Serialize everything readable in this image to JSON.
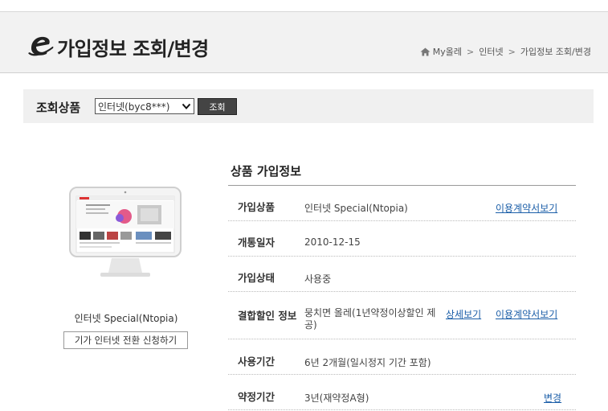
{
  "header": {
    "title": "가입정보 조회/변경",
    "breadcrumb": [
      "My올레",
      "인터넷",
      "가입정보 조회/변경"
    ],
    "breadcrumb_separator": ">"
  },
  "query": {
    "label": "조회상품",
    "selected_product": "인터넷(byc8***)",
    "button_label": "조회"
  },
  "product": {
    "name": "인터넷 Special(Ntopia)",
    "switch_button_label": "기가 인터넷 전환 신청하기"
  },
  "info": {
    "section_title": "상품 가입정보",
    "rows": [
      {
        "label": "가입상품",
        "value": "인터넷 Special(Ntopia)",
        "links": [
          "이용계약서보기"
        ]
      },
      {
        "label": "개통일자",
        "value": "2010-12-15"
      },
      {
        "label": "가입상태",
        "value": "사용중"
      },
      {
        "label": "결합할인 정보",
        "value": "뭉치면 올레(1년약정이상할인 제공)",
        "links": [
          "상세보기",
          "이용계약서보기"
        ]
      },
      {
        "label": "사용기간",
        "value": "6년 2개월(일시정지 기간 포함)"
      },
      {
        "label": "약정기간",
        "value": "3년(재약정A형)",
        "links": [
          "변경"
        ]
      }
    ]
  },
  "colors": {
    "header_bg": "#f2f2f2",
    "link": "#1b5ea8",
    "button_dark": "#444444"
  }
}
